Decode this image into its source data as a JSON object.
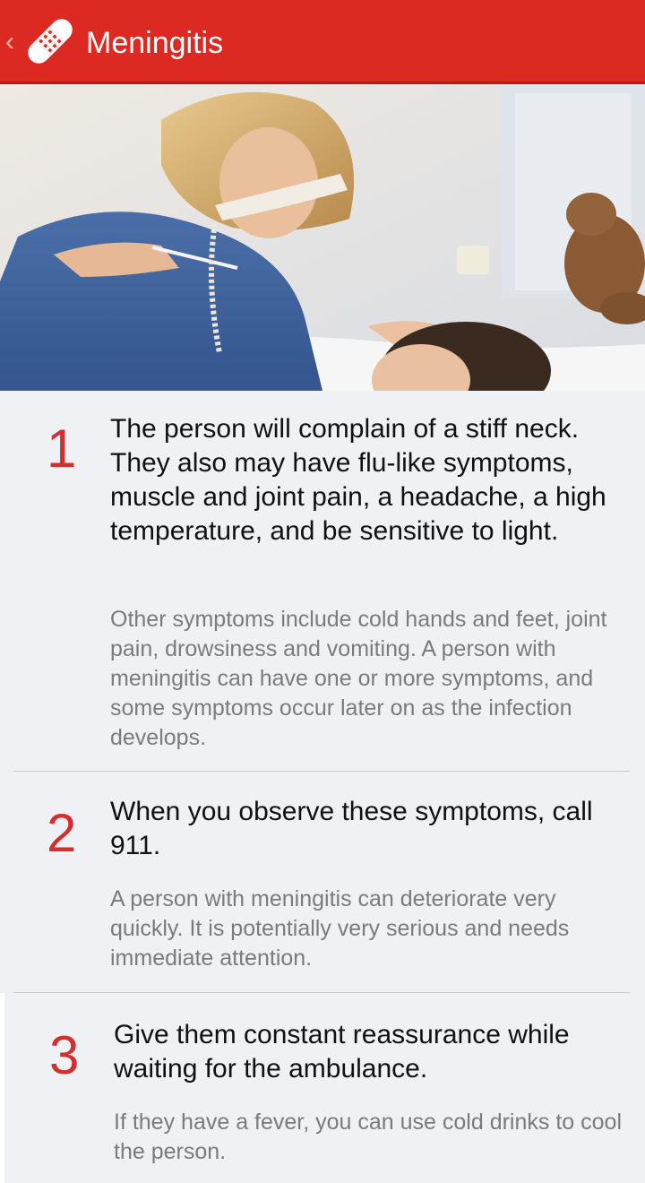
{
  "app_bar": {
    "title": "Meningitis",
    "back_icon": "chevron-left-icon",
    "logo_icon": "bandage-icon",
    "color": "#dc2a23"
  },
  "hero_image": {
    "description_icon": "photo"
  },
  "steps": [
    {
      "number": "1",
      "heading": "The person will complain of a stiff neck. They also may have flu-like symptoms, muscle and joint pain, a headache, a high temperature, and be sensitive to light.",
      "detail": "Other symptoms include cold hands and feet, joint pain, drowsiness and vomiting. A person with meningitis can have one or more symptoms, and some symptoms occur later on as the infection develops."
    },
    {
      "number": "2",
      "heading": "When you observe these symptoms, call 911.",
      "detail": "A person with meningitis can deteriorate very quickly. It is potentially very serious and needs immediate attention."
    },
    {
      "number": "3",
      "heading": "Give them constant reassurance while waiting for the ambulance.",
      "detail": "If they have a fever, you can use cold drinks to cool the person."
    }
  ],
  "colors": {
    "accent": "#dc2a23",
    "step_number": "#d32f2f",
    "heading_text": "#111111",
    "detail_text": "#7b7b7b",
    "background": "#eff1f4"
  }
}
